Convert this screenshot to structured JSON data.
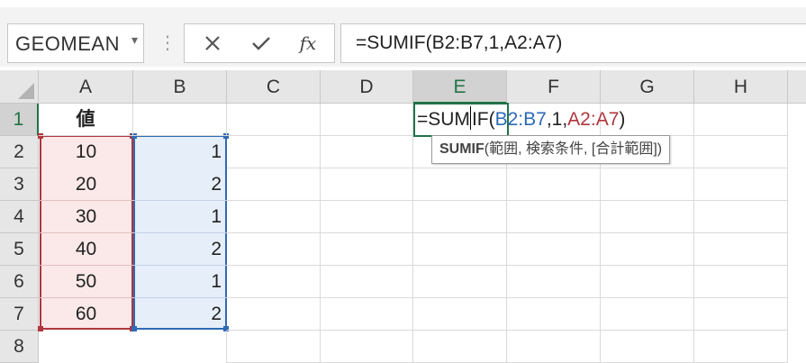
{
  "formula_bar": {
    "name_box": "GEOMEAN",
    "name_box_arrow": "▾",
    "separator": "⋮",
    "cancel_icon": "close-icon",
    "enter_icon": "check-icon",
    "fx_label": "fx",
    "formula": "=SUMIF(B2:B7,1,A2:A7)"
  },
  "sheet": {
    "columns": [
      "A",
      "B",
      "C",
      "D",
      "E",
      "F",
      "G",
      "H"
    ],
    "rows": [
      "1",
      "2",
      "3",
      "4",
      "5",
      "6",
      "7",
      "8"
    ],
    "header_a1": "値",
    "values_a": [
      "10",
      "20",
      "30",
      "40",
      "50",
      "60"
    ],
    "values_b": [
      "1",
      "2",
      "1",
      "2",
      "1",
      "2"
    ]
  },
  "edit": {
    "part1": "=SUM",
    "part2": "IF(",
    "ref1": "B2:B7",
    "mid": ",1,",
    "ref2": "A2:A7",
    "end": ")"
  },
  "tooltip": {
    "func": "SUMIF",
    "args": "(範囲, 検索条件, [合計範囲])"
  },
  "colors": {
    "accent": "#217346",
    "ref1": "#2e6ab6",
    "ref2": "#b0363e"
  }
}
